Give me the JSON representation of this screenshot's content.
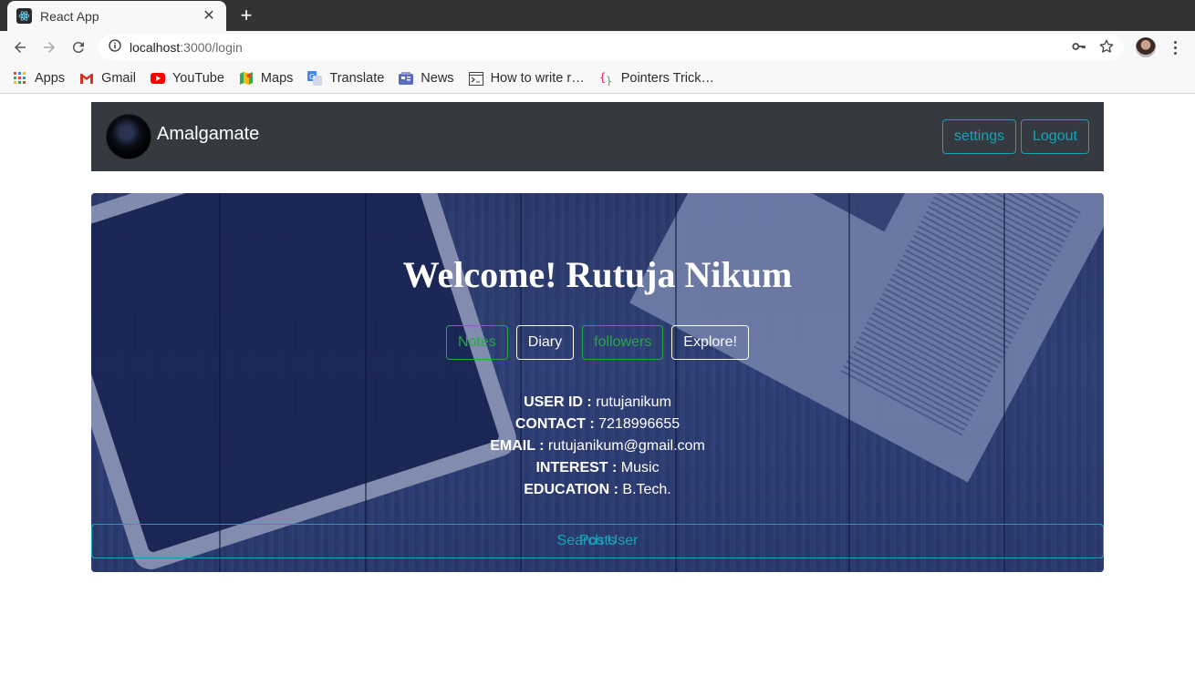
{
  "browser": {
    "tab_title": "React App",
    "tab_close": "✕",
    "new_tab": "+",
    "url_host": "localhost",
    "url_path": ":3000/login",
    "bookmarks": [
      {
        "label": "Apps",
        "icon": "apps-grid-icon"
      },
      {
        "label": "Gmail",
        "icon": "gmail-icon"
      },
      {
        "label": "YouTube",
        "icon": "youtube-icon"
      },
      {
        "label": "Maps",
        "icon": "maps-icon"
      },
      {
        "label": "Translate",
        "icon": "translate-icon"
      },
      {
        "label": "News",
        "icon": "news-icon"
      },
      {
        "label": "How to write r…",
        "icon": "terminal-icon"
      },
      {
        "label": "Pointers Trick…",
        "icon": "code-braces-icon"
      }
    ]
  },
  "navbar": {
    "brand": "Amalgamate",
    "settings_label": "settings",
    "logout_label": "Logout"
  },
  "hero": {
    "welcome": "Welcome! Rutuja Nikum",
    "buttons": [
      {
        "label": "Notes",
        "variant": "success"
      },
      {
        "label": "Diary",
        "variant": "light"
      },
      {
        "label": "Posts",
        "variant": "info"
      },
      {
        "label": "followers",
        "variant": "success"
      },
      {
        "label": "Explore!",
        "variant": "light"
      },
      {
        "label": "Search User",
        "variant": "info"
      }
    ],
    "profile": [
      {
        "key": "USER ID :",
        "value": "rutujanikum"
      },
      {
        "key": "CONTACT :",
        "value": "7218996655"
      },
      {
        "key": "EMAIL :",
        "value": "rutujanikum@gmail.com"
      },
      {
        "key": "INTEREST :",
        "value": "Music"
      },
      {
        "key": "EDUCATION :",
        "value": "B.Tech."
      }
    ]
  },
  "colors": {
    "navbar_bg": "#343a40",
    "info": "#17a2b8",
    "success": "#28a745",
    "light": "#f8f9fa"
  }
}
